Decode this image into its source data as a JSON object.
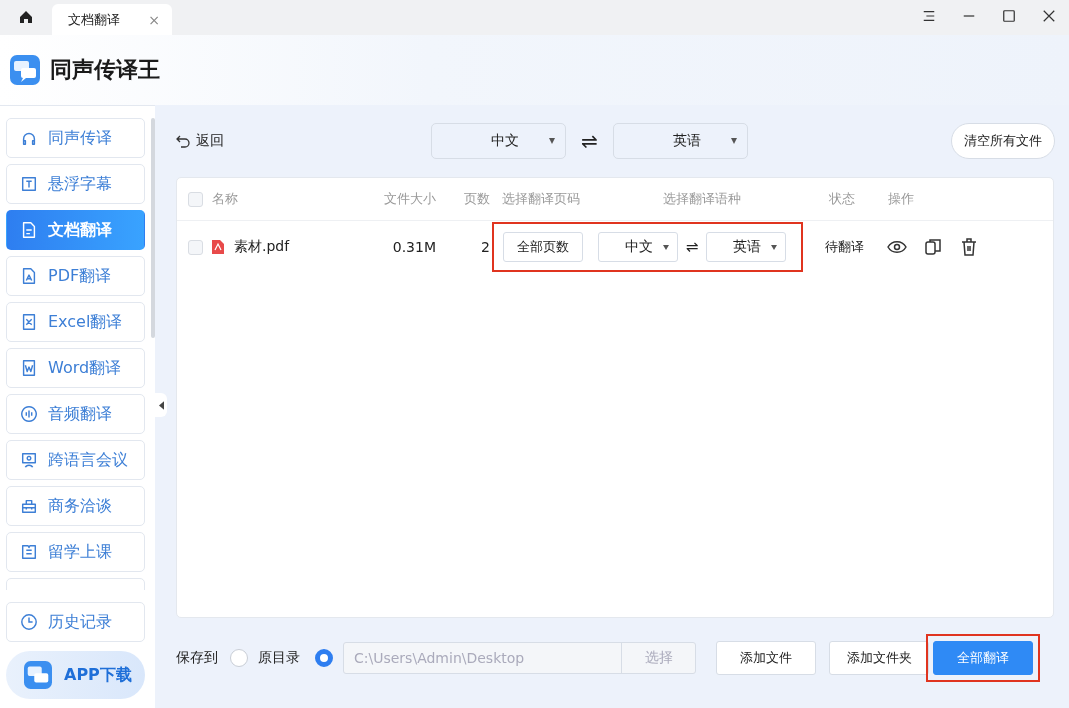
{
  "titlebar": {
    "tabs": [
      {
        "label": "文档翻译",
        "selected": true,
        "close": "×"
      }
    ]
  },
  "app": {
    "name": "同声传译王"
  },
  "sidebar": {
    "items": [
      {
        "label": "同声传译",
        "selected": false
      },
      {
        "label": "悬浮字幕",
        "selected": false
      },
      {
        "label": "文档翻译",
        "selected": true
      },
      {
        "label": "PDF翻译",
        "selected": false
      },
      {
        "label": "Excel翻译",
        "selected": false
      },
      {
        "label": "Word翻译",
        "selected": false
      },
      {
        "label": "音频翻译",
        "selected": false
      },
      {
        "label": "跨语言会议",
        "selected": false
      },
      {
        "label": "商务洽谈",
        "selected": false
      },
      {
        "label": "留学上课",
        "selected": false
      }
    ],
    "history": {
      "label": "历史记录"
    },
    "download": {
      "label": "APP下载"
    }
  },
  "toolbar": {
    "back": "返回",
    "source_language": "中文",
    "swap": "⇌",
    "target_language": "英语",
    "clear": "清空所有文件"
  },
  "table": {
    "select_all": {
      "checked": false
    },
    "columns": [
      "名称",
      "文件大小",
      "页数",
      "选择翻译页码",
      "选择翻译语种",
      "状态",
      "操作"
    ],
    "rows": [
      {
        "checked": false,
        "name": "素材.pdf",
        "size": "0.31M",
        "pages": "2",
        "page_range": "全部页数",
        "source_language": "中文",
        "swap": "⇌",
        "target_language": "英语",
        "status": "待翻译",
        "highlighted": true
      }
    ]
  },
  "footer": {
    "label": "保存到",
    "options": [
      {
        "kind": "original",
        "label": "原目录",
        "selected": false
      },
      {
        "kind": "custom",
        "path": "C:\\Users\\Admin\\Desktop",
        "selected": true
      }
    ],
    "choose": "选择",
    "buttons": [
      {
        "label": "添加文件",
        "primary": false,
        "highlighted": false
      },
      {
        "label": "添加文件夹",
        "primary": false,
        "highlighted": false
      },
      {
        "label": "全部翻译",
        "primary": true,
        "highlighted": true
      }
    ]
  }
}
